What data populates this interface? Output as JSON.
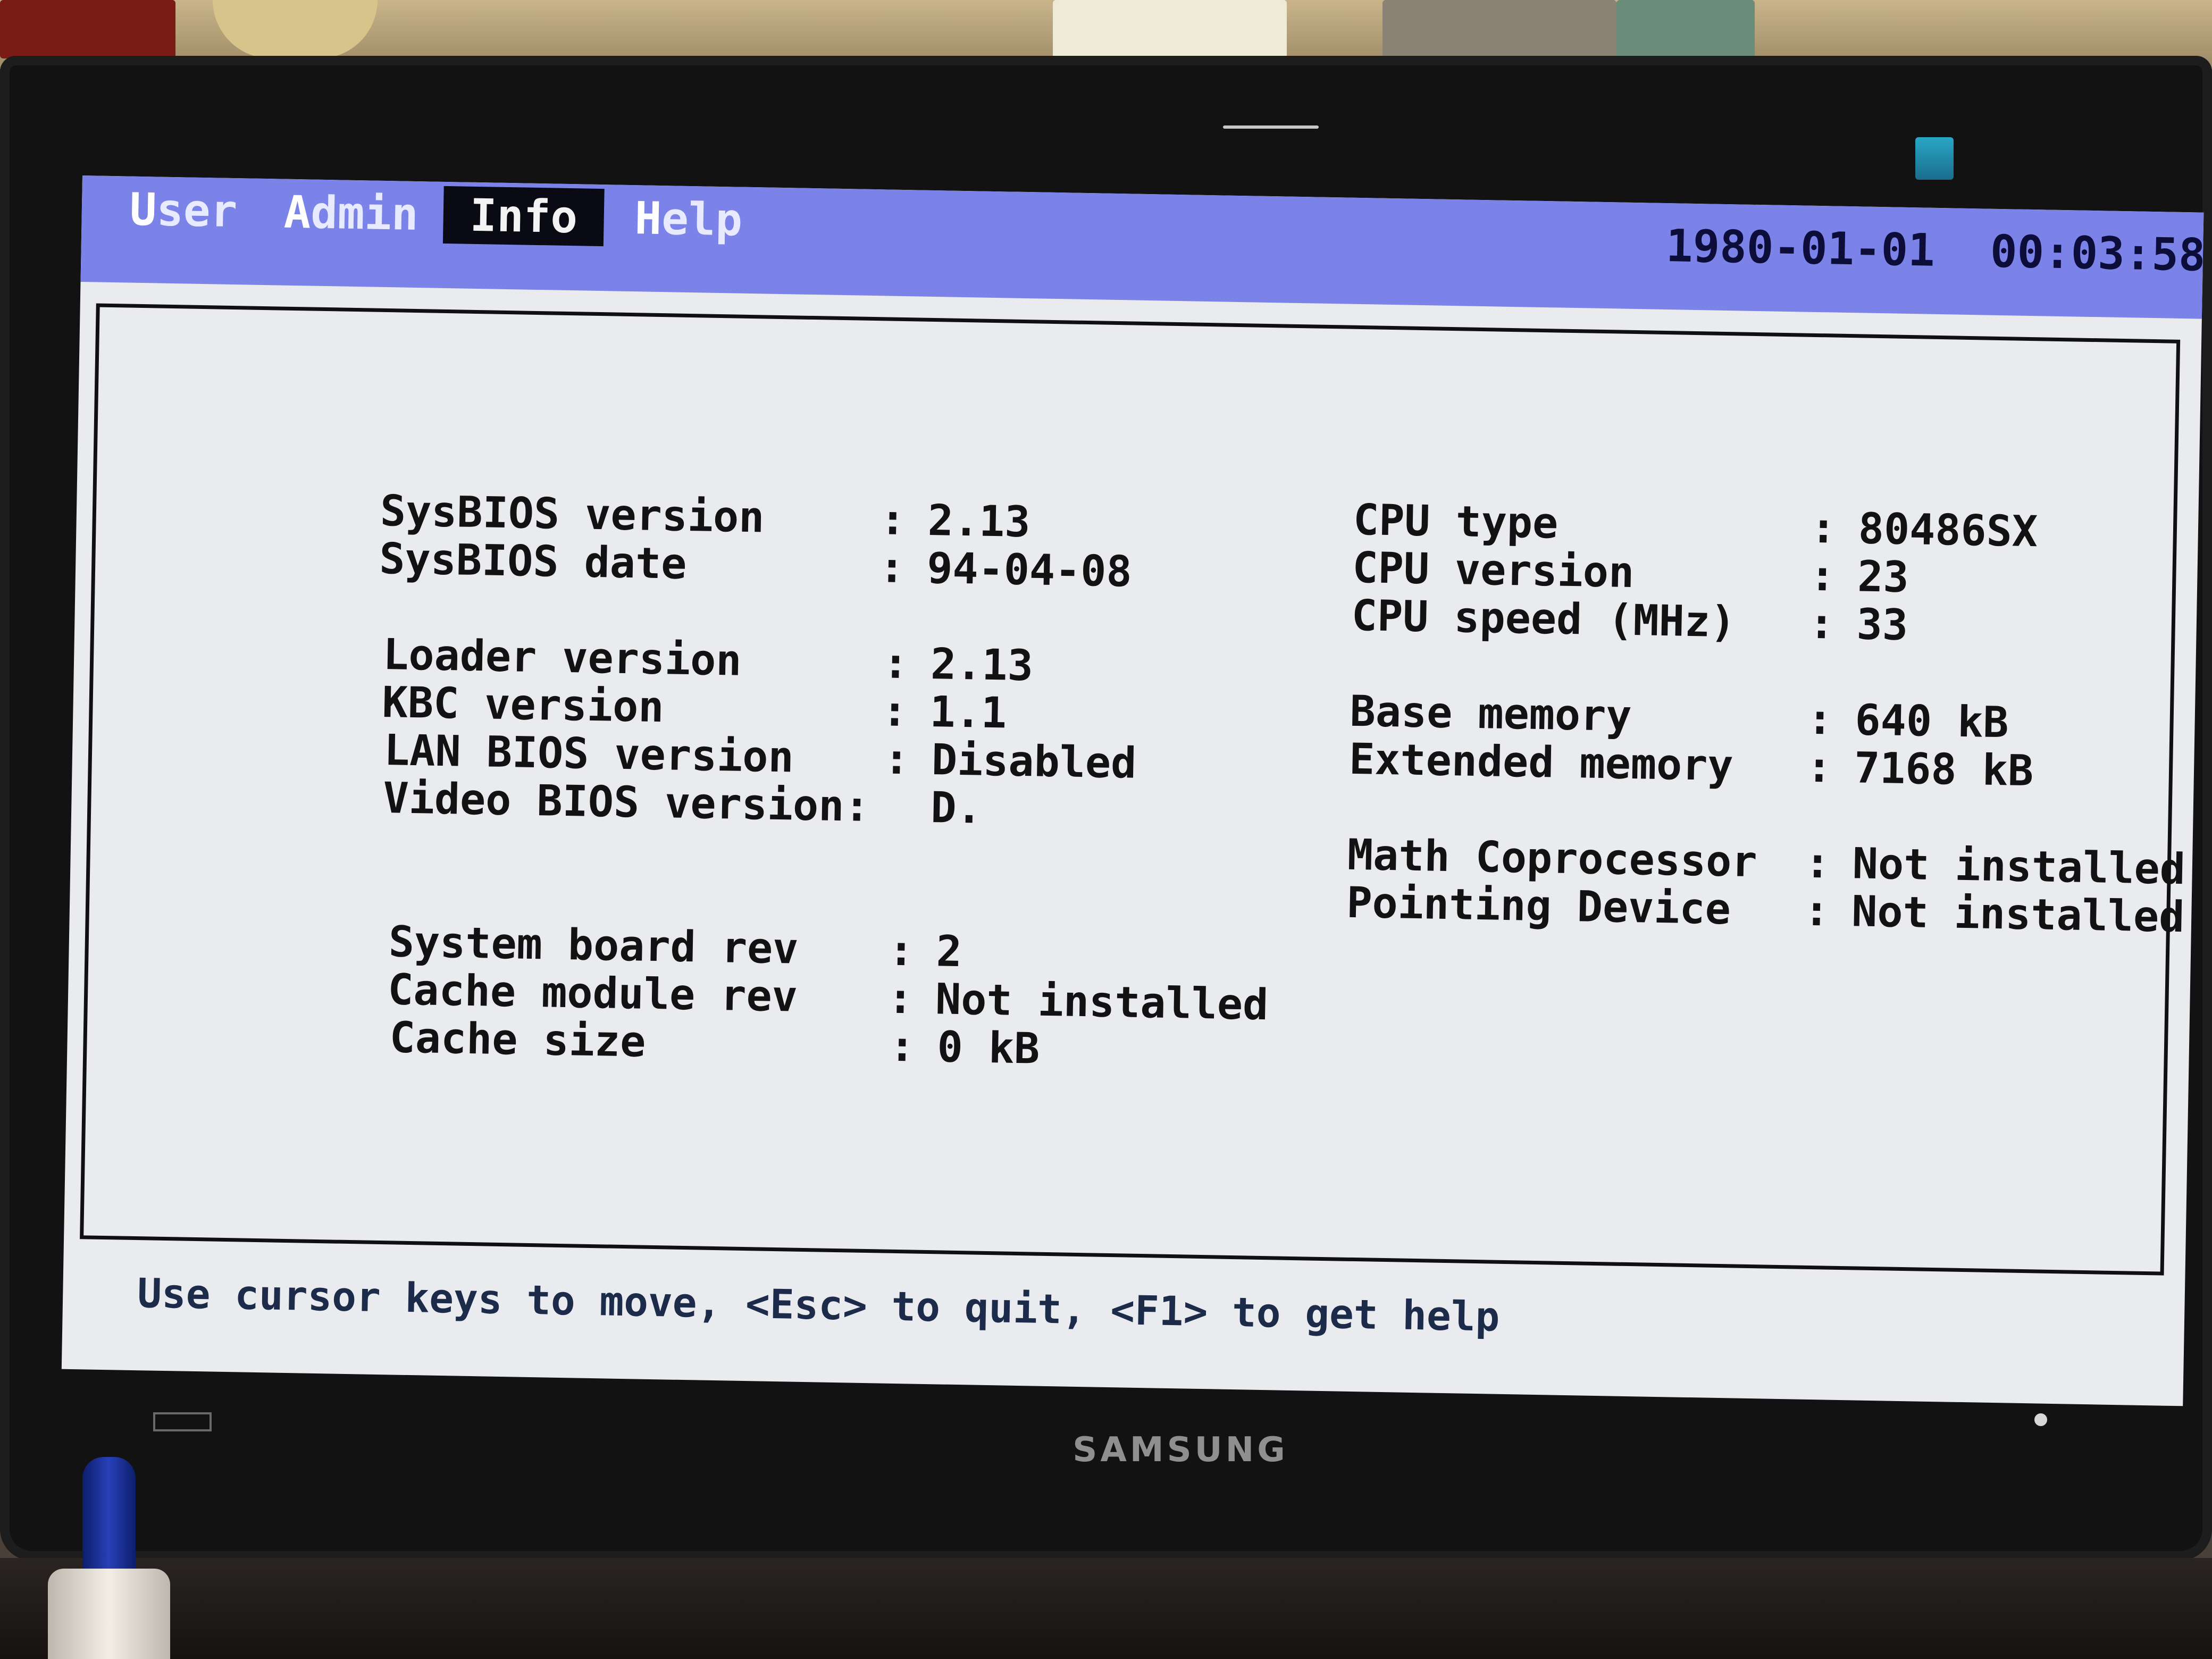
{
  "menu": {
    "items": [
      {
        "hotkey": "U",
        "rest": "ser"
      },
      {
        "hotkey": "A",
        "rest": "dmin"
      },
      {
        "hotkey": "",
        "rest": "Info"
      },
      {
        "hotkey": "H",
        "rest": "elp"
      }
    ],
    "active_index": 2
  },
  "clock": {
    "date": "1980-01-01",
    "time": "00:03:58"
  },
  "info_left": [
    {
      "label": "SysBIOS version",
      "sep": ":",
      "value": "2.13"
    },
    {
      "label": "SysBIOS date",
      "sep": ":",
      "value": "94-04-08"
    },
    {
      "label": "Loader version",
      "sep": ":",
      "value": "2.13"
    },
    {
      "label": "KBC version",
      "sep": ":",
      "value": "1.1"
    },
    {
      "label": "LAN BIOS version",
      "sep": ":",
      "value": "Disabled"
    },
    {
      "label": "Video BIOS version:",
      "sep": "",
      "value": "D."
    },
    {
      "label": "System board rev",
      "sep": ":",
      "value": "2"
    },
    {
      "label": "Cache module rev",
      "sep": ":",
      "value": "Not installed"
    },
    {
      "label": "Cache size",
      "sep": ":",
      "value": "0 kB"
    }
  ],
  "info_right": [
    {
      "label": "CPU type",
      "sep": ":",
      "value": "80486SX"
    },
    {
      "label": "CPU version",
      "sep": ":",
      "value": "23"
    },
    {
      "label": "CPU speed (MHz)",
      "sep": ":",
      "value": "33"
    },
    {
      "label": "Base memory",
      "sep": ":",
      "value": "640 kB"
    },
    {
      "label": "Extended memory",
      "sep": ":",
      "value": "7168 kB"
    },
    {
      "label": "Math Coprocessor",
      "sep": ":",
      "value": "Not installed"
    },
    {
      "label": "Pointing Device",
      "sep": ":",
      "value": "Not installed"
    }
  ],
  "hint": "Use cursor keys to move, <Esc> to quit, <F1> to get help",
  "monitor": {
    "brand": "SAMSUNG"
  },
  "colors": {
    "menubar": "#7b82e8",
    "menu_active_bg": "#0a0a14",
    "screen_bg": "#e9ebee",
    "text": "#121212",
    "hint_text": "#1c2b4a"
  }
}
